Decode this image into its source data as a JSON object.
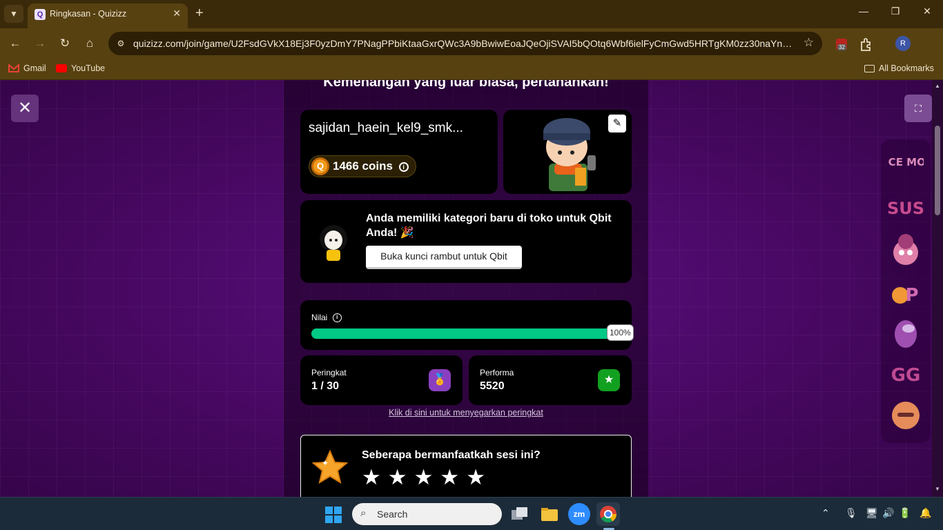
{
  "browser": {
    "tab_title": "Ringkasan - Quizizz",
    "tab_favicon": "Q",
    "url": "quizizz.com/join/game/U2FsdGVkX18Ej3F0yzDmY7PNagPPbiKtaaGxrQWc3A9bBwiwEoaJQeOjiSVAI5bQOtq6Wbf6ielFyCmGwd5HRTgKM0zz30naYnBdBGq...",
    "extension_badge": "32",
    "profile_initial": "R",
    "bookmarks": [
      {
        "label": "Gmail",
        "icon": "gmail-icon"
      },
      {
        "label": "YouTube",
        "icon": "youtube-icon"
      }
    ],
    "all_bookmarks": "All Bookmarks"
  },
  "game": {
    "headline": "Kemenangan yang luar biasa, pertahankan!",
    "player_name": "sajidan_haein_kel9_smk...",
    "coins": "1466 coins",
    "coin_icon_letter": "Q",
    "promo": {
      "title": "Anda memiliki kategori baru di toko untuk Qbit Anda! 🎉",
      "button": "Buka kunci rambut untuk Qbit"
    },
    "score": {
      "label": "Nilai",
      "percent": 100,
      "percent_label": "100%"
    },
    "rank": {
      "label": "Peringkat",
      "value": "1 / 30"
    },
    "performance": {
      "label": "Performa",
      "value": "5520"
    },
    "refresh_link": "Klik di sini untuk menyegarkan peringkat",
    "feedback": {
      "question": "Seberapa bermanfaatkah sesi ini?",
      "stars": 5
    },
    "stickers": [
      "ONCE MORE",
      "SUS",
      "",
      "OP",
      "",
      "GG",
      ""
    ]
  },
  "taskbar": {
    "search_placeholder": "Search",
    "apps": [
      "start-icon",
      "task-view-icon",
      "file-explorer-icon",
      "zoom-icon",
      "chrome-icon"
    ]
  },
  "colors": {
    "progress_fill": "#00c985",
    "rank_icon_bg": "#8a3fc0",
    "performance_icon_bg": "#12a020",
    "page_bg": "#4a0866"
  }
}
